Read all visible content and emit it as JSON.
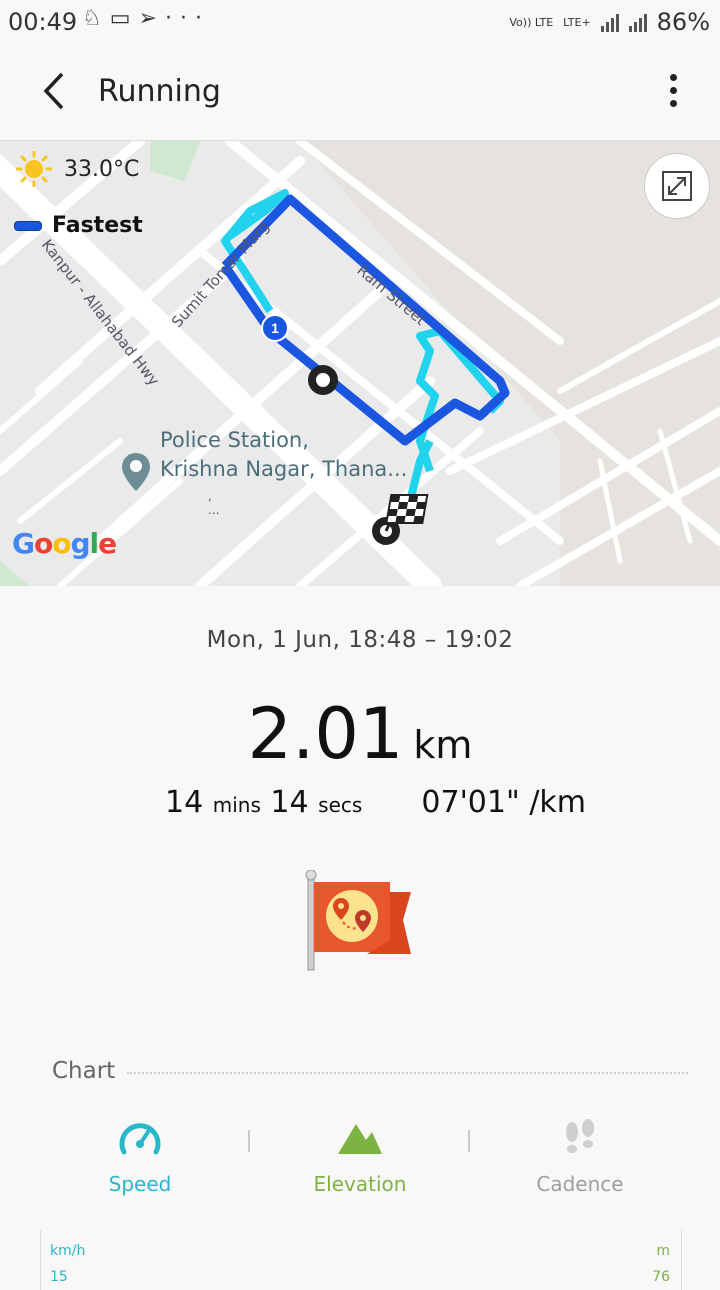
{
  "status_bar": {
    "time": "00:49",
    "network_label_1": "Vo)) LTE",
    "network_label_2": "LTE+",
    "battery": "86%",
    "icons": [
      "silent-mode-icon",
      "laptop-icon",
      "telegram-icon",
      "more-notifications-icon"
    ]
  },
  "app_bar": {
    "title": "Running",
    "back_icon": "back-arrow-icon",
    "menu_icon": "more-vert-icon"
  },
  "map": {
    "weather_temp": "33.0°C",
    "legend_label": "Fastest",
    "poi_label_line1": "Police Station,",
    "poi_label_line2": "Krishna Nagar, Thana...",
    "street_1": "Kanpur - Allahabad Hwy",
    "street_2": "Sumit Tomar Marg",
    "street_3": "Ram Street",
    "marker_1_label": "1",
    "google_logo": "Google",
    "colors": {
      "route": "#1a56e0",
      "route_alt": "#22d3ee"
    }
  },
  "workout": {
    "date_time": "Mon, 1 Jun, 18:48 – 19:02",
    "distance_value": "2.01",
    "distance_unit": "km",
    "duration_mins": "14",
    "mins_label": "mins",
    "duration_secs": "14",
    "secs_label": "secs",
    "pace": "07'01\" /km"
  },
  "chart": {
    "header": "Chart",
    "tabs": [
      {
        "label": "Speed",
        "color": "#2ab7ca",
        "icon": "speedometer-icon"
      },
      {
        "label": "Elevation",
        "color": "#7cb342",
        "icon": "mountain-icon"
      },
      {
        "label": "Cadence",
        "color": "#9e9e9e",
        "icon": "footprints-icon"
      }
    ],
    "left_axis_unit": "km/h",
    "left_axis_top": "15",
    "right_axis_unit": "m",
    "right_axis_top": "76"
  }
}
